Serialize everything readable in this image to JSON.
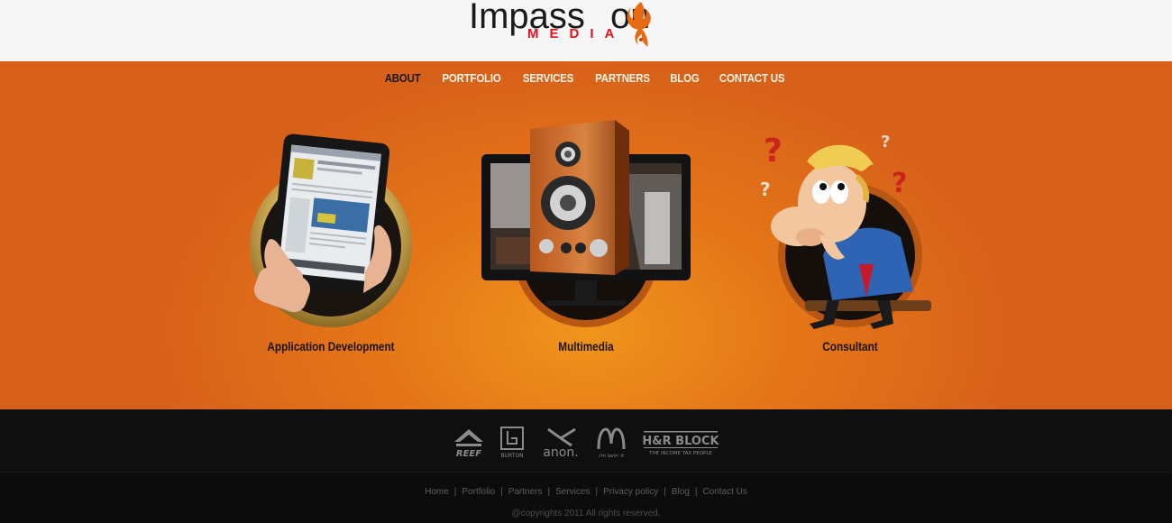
{
  "brand": {
    "name_part1": "Impass",
    "name_part2": "on",
    "subtitle": "MEDIA",
    "accent_color": "#e1131d",
    "flame_color": "#e66a12"
  },
  "nav": {
    "items": [
      {
        "label": "ABOUT",
        "active": true
      },
      {
        "label": "PORTFOLIO",
        "active": false
      },
      {
        "label": "SERVICES",
        "active": false
      },
      {
        "label": "PARTNERS",
        "active": false
      },
      {
        "label": "BLOG",
        "active": false
      },
      {
        "label": "CONTACT US",
        "active": false
      }
    ]
  },
  "services": [
    {
      "label": "Application Development",
      "icon": "tablet-icon"
    },
    {
      "label": "Multimedia",
      "icon": "speaker-monitor-icon"
    },
    {
      "label": "Consultant",
      "icon": "thinking-man-icon"
    }
  ],
  "partners": [
    {
      "name": "REEF",
      "icon": "reef-logo"
    },
    {
      "name": "BURTON",
      "icon": "burton-logo"
    },
    {
      "name": "anon.",
      "icon": "anon-logo"
    },
    {
      "name": "i'm lovin' it",
      "icon": "mcdonalds-logo"
    },
    {
      "name": "H&R BLOCK",
      "tagline": "THE INCOME TAX PEOPLE",
      "icon": "hrblock-logo"
    }
  ],
  "footer": {
    "links": [
      "Home",
      "Portfolio",
      "Partners",
      "Services",
      "Privacy policy",
      "Blog",
      "Contact Us"
    ],
    "separator": "|",
    "copyright": "@copyrights 2011 All rights reserved."
  },
  "colors": {
    "header_bg": "#f6f6f6",
    "hero_orange": "#e57718",
    "footer_bg": "#0f0f0f"
  }
}
